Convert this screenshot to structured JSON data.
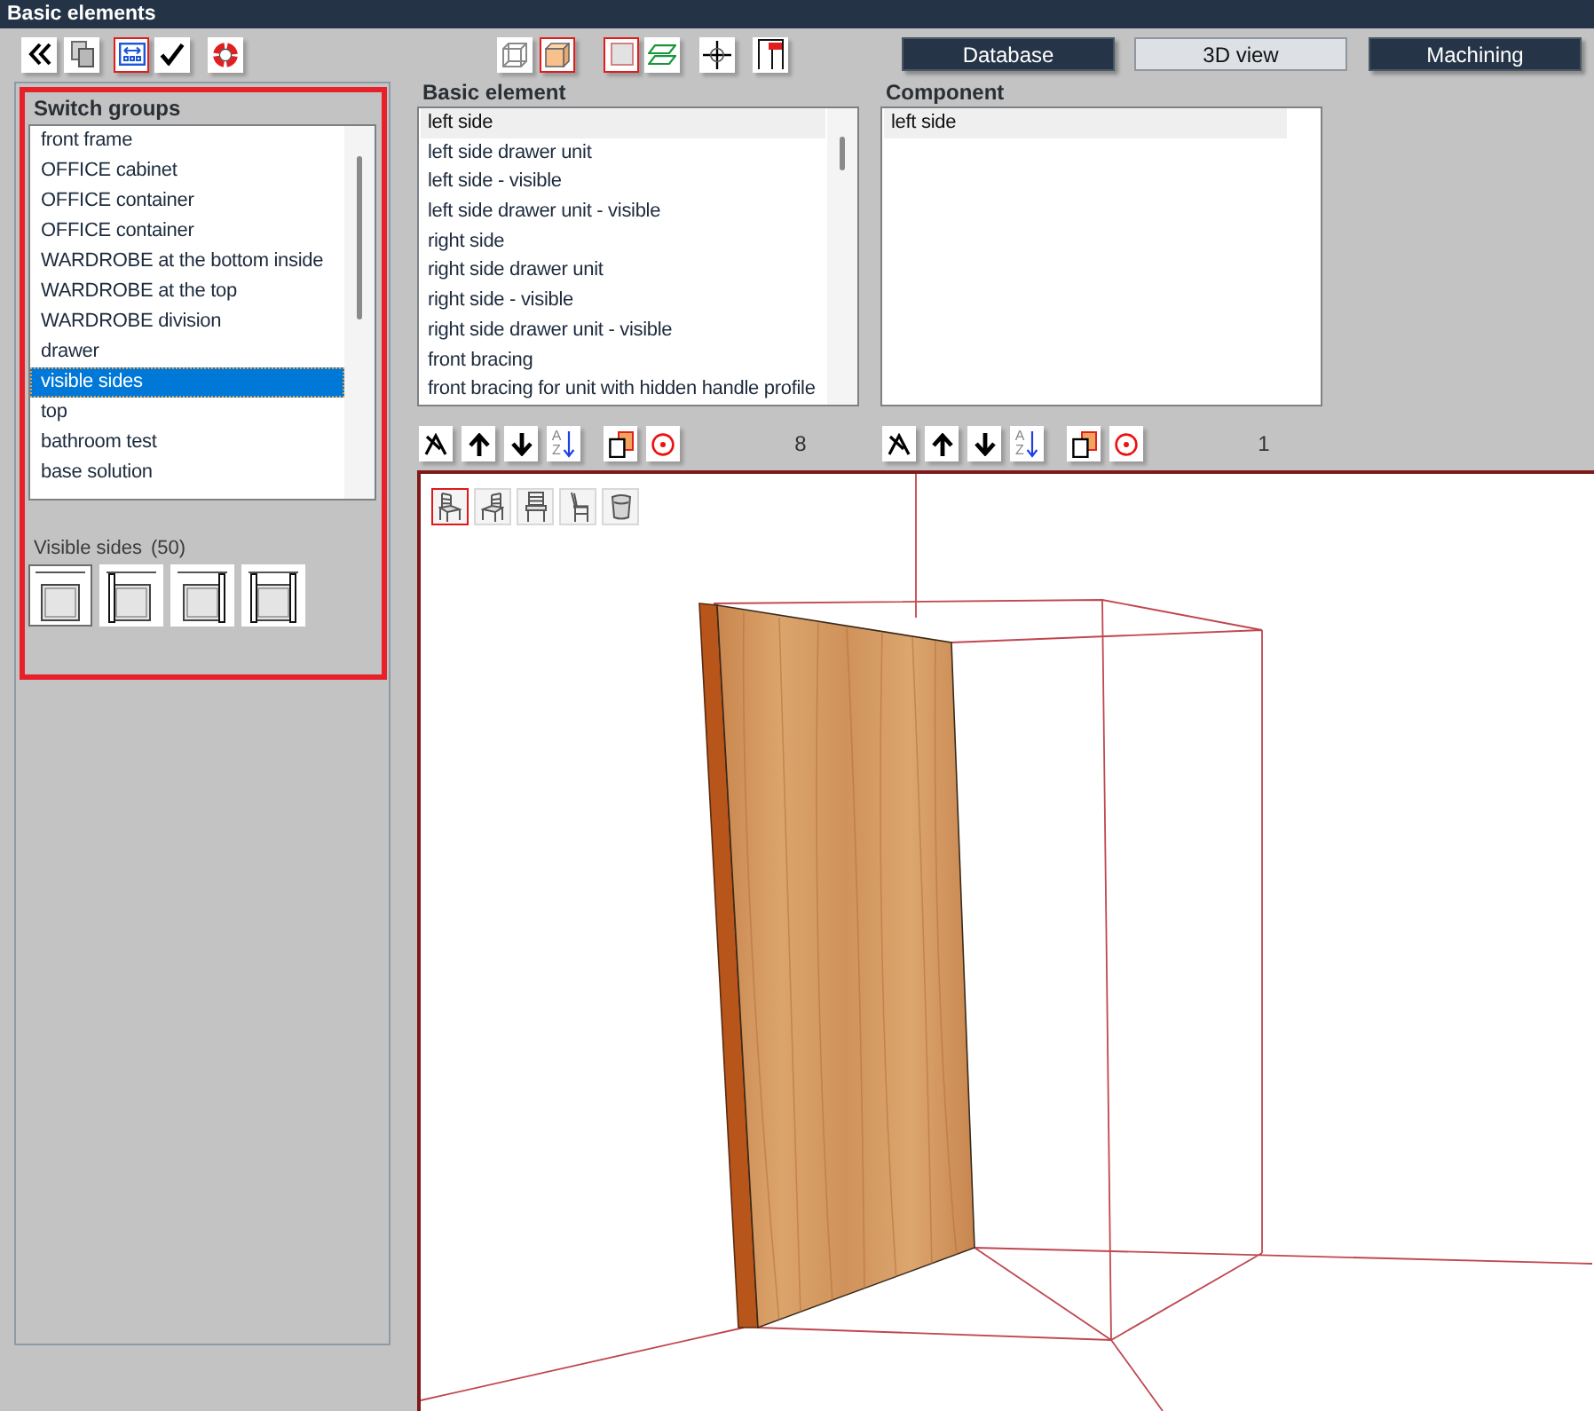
{
  "window": {
    "title": "Basic elements"
  },
  "toolbar": {
    "left_tools": [
      {
        "kind": "collapse",
        "selected": false
      },
      {
        "kind": "copy",
        "selected": false
      },
      {
        "kind": "fit",
        "selected": true
      },
      {
        "kind": "confirm",
        "selected": false
      },
      {
        "kind": "help",
        "selected": false
      }
    ],
    "view_tools": [
      {
        "kind": "wireframe",
        "selected": false
      },
      {
        "kind": "solid",
        "selected": true
      },
      {
        "kind": "panel",
        "selected": true
      },
      {
        "kind": "layers",
        "selected": false
      },
      {
        "kind": "crosshair",
        "selected": false
      },
      {
        "kind": "flag",
        "selected": false
      }
    ],
    "tabs": [
      {
        "label": "Database",
        "selected": false
      },
      {
        "label": "3D view",
        "selected": true
      },
      {
        "label": "Machining",
        "selected": false
      }
    ]
  },
  "switch_groups": {
    "title": "Switch groups",
    "highlighted": true,
    "items": [
      {
        "label": "front frame",
        "selected": false
      },
      {
        "label": "OFFICE cabinet",
        "selected": false
      },
      {
        "label": "OFFICE container",
        "selected": false
      },
      {
        "label": "OFFICE container",
        "selected": false
      },
      {
        "label": "WARDROBE at the bottom inside",
        "selected": false
      },
      {
        "label": "WARDROBE at the top",
        "selected": false
      },
      {
        "label": "WARDROBE division",
        "selected": false
      },
      {
        "label": "drawer",
        "selected": false
      },
      {
        "label": "visible sides",
        "selected": true
      },
      {
        "label": "top",
        "selected": false
      },
      {
        "label": "bathroom test",
        "selected": false
      },
      {
        "label": "base solution",
        "selected": false
      }
    ]
  },
  "visible_sides": {
    "label": "Visible sides",
    "count": "(50)",
    "options": [
      {
        "kind": "none",
        "selected": true
      },
      {
        "kind": "left",
        "selected": false
      },
      {
        "kind": "right",
        "selected": false
      },
      {
        "kind": "both",
        "selected": false
      }
    ]
  },
  "basic_element": {
    "title": "Basic element",
    "items": [
      {
        "label": "left side",
        "selected": true
      },
      {
        "label": "left side drawer unit",
        "selected": false
      },
      {
        "label": "left side - visible",
        "selected": false
      },
      {
        "label": "left side drawer unit - visible",
        "selected": false
      },
      {
        "label": "right side",
        "selected": false
      },
      {
        "label": "right side drawer unit",
        "selected": false
      },
      {
        "label": "right side - visible",
        "selected": false
      },
      {
        "label": "right side drawer unit - visible",
        "selected": false
      },
      {
        "label": "front bracing",
        "selected": false
      },
      {
        "label": "front bracing for unit with hidden handle profile",
        "selected": false
      }
    ],
    "sort_letters": [
      "A",
      "Z"
    ],
    "count": "8"
  },
  "component": {
    "title": "Component",
    "items": [
      {
        "label": "left side",
        "selected": true
      }
    ],
    "sort_letters": [
      "A",
      "Z"
    ],
    "count": "1"
  },
  "viewport": {
    "view_modes": [
      {
        "kind": "left",
        "selected": true
      },
      {
        "kind": "right",
        "selected": false
      },
      {
        "kind": "front",
        "selected": false
      },
      {
        "kind": "side",
        "selected": false
      },
      {
        "kind": "stool",
        "selected": false
      }
    ]
  }
}
